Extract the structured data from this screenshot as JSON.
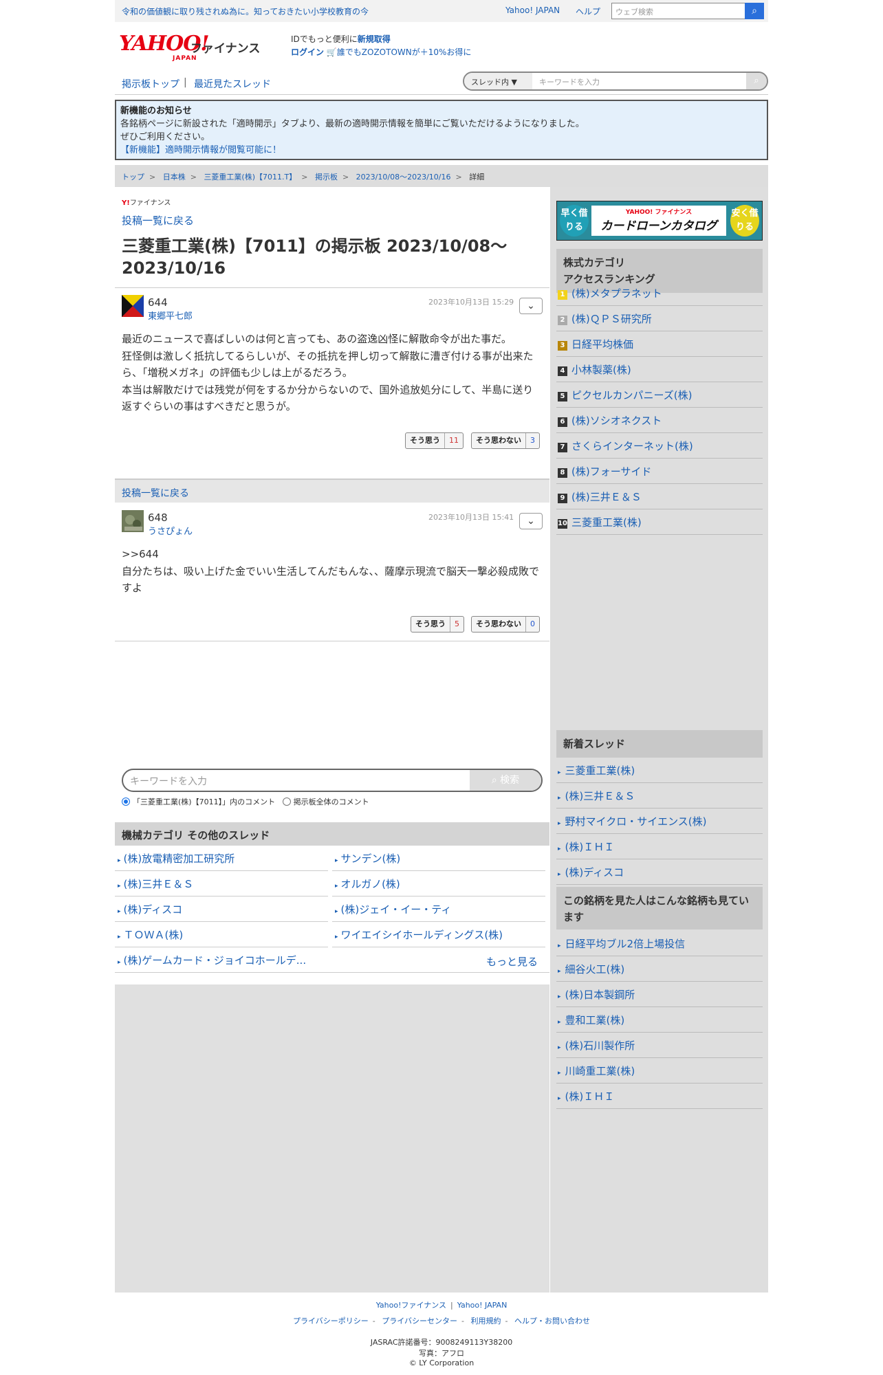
{
  "topbar": {
    "promo": "令和の価値観に取り残されぬ為に。知っておきたい小学校教育の今",
    "yahoo_japan": "Yahoo! JAPAN",
    "help": "ヘルプ",
    "search_placeholder": "ウェブ検索"
  },
  "header": {
    "logo_main": "YAHOO!",
    "logo_sub": "JAPAN",
    "logo_section": "ファイナンス",
    "id_text": "IDでもっと便利に",
    "register": "新規取得",
    "login": "ログイン",
    "zozo": "誰でもZOZOTOWNが＋10%お得に"
  },
  "nav": {
    "board_top": "掲示板トップ",
    "separator": "|",
    "recent": "最近見たスレッド",
    "scope": "スレッド内",
    "keyword_placeholder": "キーワードを入力"
  },
  "notice": {
    "title": "新機能のお知らせ",
    "line1": "各銘柄ページに新設された「適時開示」タブより、最新の適時開示情報を簡単にご覧いただけるようになりました。",
    "line2": "ぜひご利用ください。",
    "link": "【新機能】適時開示情報が閲覧可能に！"
  },
  "breadcrumb": [
    "トップ",
    "日本株",
    "三菱重工業(株)【7011.T】",
    "掲示板",
    "2023/10/08〜2023/10/16",
    "詳細"
  ],
  "main": {
    "yfin_label": "ファイナンス",
    "back_link": "投稿一覧に戻る",
    "title": "三菱重工業(株)【7011】の掲示板 2023/10/08〜2023/10/16",
    "posts": [
      {
        "number": "644",
        "author": "東郷平七郎",
        "date": "2023年10月13日 15:29",
        "body": "最近のニュースで喜ばしいのは何と言っても、あの盗逸凶怪に解散命令が出た事だ。\n狂怪側は激しく抵抗してるらしいが、その抵抗を押し切って解散に漕ぎ付ける事が出来たら、「増税メガネ」の評価も少しは上がるだろう。\n本当は解散だけでは残党が何をするか分からないので、国外追放処分にして、半島に送り返すぐらいの事はすべきだと思うが。",
        "agree_label": "そう思う",
        "agree": "11",
        "disagree_label": "そう思わない",
        "disagree": "3"
      },
      {
        "number": "648",
        "author": "うさぴょん",
        "date": "2023年10月13日 15:41",
        "body": ">>644\n自分たちは、吸い上げた金でいい生活してんだもんな、、薩摩示現流で脳天一撃必殺成敗ですよ",
        "agree_label": "そう思う",
        "agree": "5",
        "disagree_label": "そう思わない",
        "disagree": "0"
      }
    ],
    "search_placeholder": "キーワードを入力",
    "search_button": "検索",
    "radio_thread": "「三菱重工業(株)【7011】」内のコメント",
    "radio_all": "掲示板全体のコメント",
    "category_title": "機械カテゴリ その他のスレッド",
    "category_threads": [
      "(株)放電精密加工研究所",
      "サンデン(株)",
      "(株)三井Ｅ＆Ｓ",
      "オルガノ(株)",
      "(株)ディスコ",
      "(株)ジェイ・イー・ティ",
      "ＴＯＷＡ(株)",
      "ワイエイシイホールディングス(株)",
      "(株)ゲームカード・ジョイコホールデ..."
    ],
    "more": "もっと見る"
  },
  "sidebar": {
    "banner": {
      "left": "早く借りる",
      "brand": "YAHOO! ファイナンス",
      "main": "カードローンカタログ",
      "right": "安く借りる"
    },
    "ranking_title": "株式カテゴリ\nアクセスランキング",
    "ranking": [
      {
        "rank": "1",
        "name": "(株)メタプラネット",
        "color": "#f2d21b"
      },
      {
        "rank": "2",
        "name": "(株)ＱＰＳ研究所",
        "color": "#aaaaaa"
      },
      {
        "rank": "3",
        "name": "日経平均株価",
        "color": "#b8860b"
      },
      {
        "rank": "4",
        "name": "小林製薬(株)",
        "color": "#333333"
      },
      {
        "rank": "5",
        "name": "ピクセルカンパニーズ(株)",
        "color": "#333333"
      },
      {
        "rank": "6",
        "name": "(株)ソシオネクスト",
        "color": "#333333"
      },
      {
        "rank": "7",
        "name": "さくらインターネット(株)",
        "color": "#333333"
      },
      {
        "rank": "8",
        "name": "(株)フォーサイド",
        "color": "#333333"
      },
      {
        "rank": "9",
        "name": "(株)三井Ｅ＆Ｓ",
        "color": "#333333"
      },
      {
        "rank": "10",
        "name": "三菱重工業(株)",
        "color": "#333333"
      }
    ],
    "new_title": "新着スレッド",
    "new_threads": [
      "三菱重工業(株)",
      "(株)三井Ｅ＆Ｓ",
      "野村マイクロ・サイエンス(株)",
      "(株)ＩＨＩ",
      "(株)ディスコ"
    ],
    "also_title": "この銘柄を見た人はこんな銘柄も見ています",
    "also": [
      "日経平均ブル2倍上場投信",
      "細谷火工(株)",
      "(株)日本製鋼所",
      "豊和工業(株)",
      "(株)石川製作所",
      "川崎重工業(株)",
      "(株)ＩＨＩ"
    ]
  },
  "footer": {
    "yfin": "Yahoo!ファイナンス",
    "yjapan": "Yahoo! JAPAN",
    "privacy_policy": "プライバシーポリシー",
    "privacy_center": "プライバシーセンター",
    "terms": "利用規約",
    "help": "ヘルプ・お問い合わせ",
    "jasrac": "JASRAC許諾番号：9008249113Y38200",
    "photo": "写真：アフロ",
    "copyright": "© LY Corporation"
  }
}
